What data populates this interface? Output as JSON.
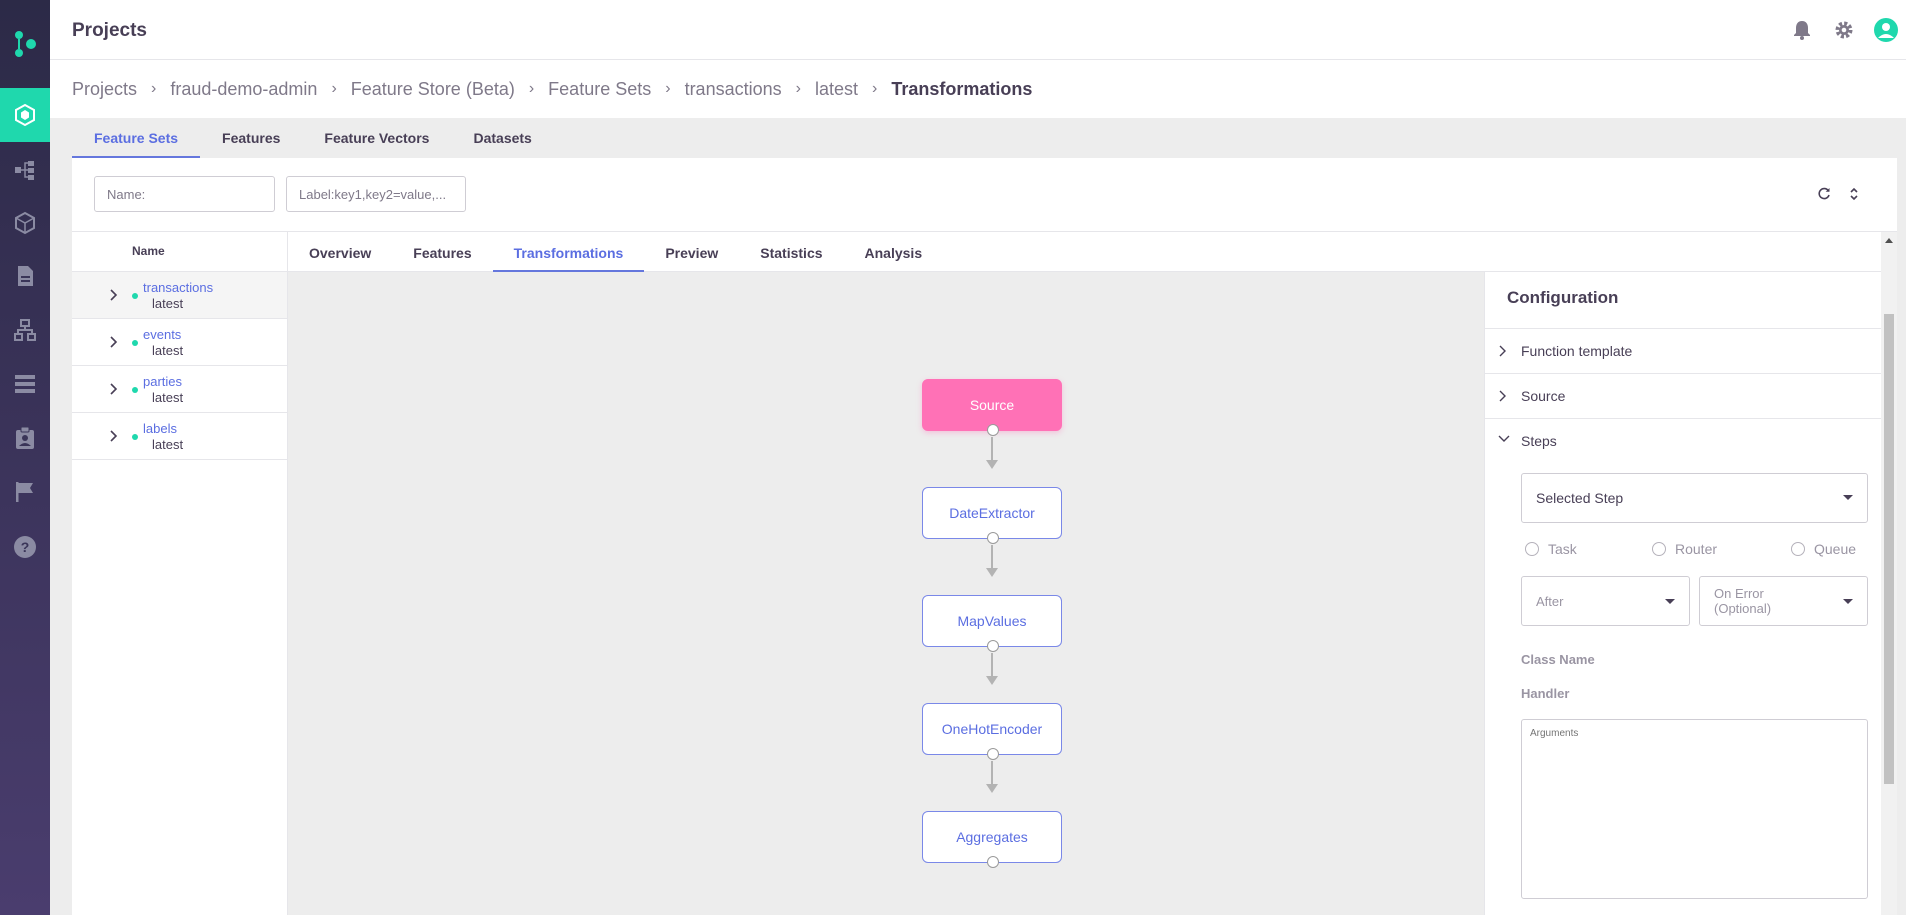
{
  "header": {
    "title": "Projects"
  },
  "breadcrumb": {
    "items": [
      "Projects",
      "fraud-demo-admin",
      "Feature Store (Beta)",
      "Feature Sets",
      "transactions",
      "latest"
    ],
    "current": "Transformations"
  },
  "content_tabs": [
    {
      "label": "Feature Sets",
      "active": true
    },
    {
      "label": "Features",
      "active": false
    },
    {
      "label": "Feature Vectors",
      "active": false
    },
    {
      "label": "Datasets",
      "active": false
    }
  ],
  "filters": {
    "name_placeholder": "Name:",
    "label_placeholder": "Label:key1,key2=value,..."
  },
  "table": {
    "header": "Name",
    "rows": [
      {
        "name": "transactions",
        "tag": "latest"
      },
      {
        "name": "events",
        "tag": "latest"
      },
      {
        "name": "parties",
        "tag": "latest"
      },
      {
        "name": "labels",
        "tag": "latest"
      }
    ]
  },
  "detail_tabs": [
    {
      "label": "Overview"
    },
    {
      "label": "Features"
    },
    {
      "label": "Transformations",
      "active": true
    },
    {
      "label": "Preview"
    },
    {
      "label": "Statistics"
    },
    {
      "label": "Analysis"
    }
  ],
  "graph": {
    "nodes": [
      "Source",
      "DateExtractor",
      "MapValues",
      "OneHotEncoder",
      "Aggregates"
    ]
  },
  "config": {
    "title": "Configuration",
    "sections": [
      "Function template",
      "Source",
      "Steps"
    ],
    "selected_step_placeholder": "Selected Step",
    "radios": [
      "Task",
      "Router",
      "Queue"
    ],
    "after_placeholder": "After",
    "on_error_placeholder": "On Error (Optional)",
    "on_error_line1": "On Error",
    "on_error_line2": "(Optional)",
    "class_name_label": "Class Name",
    "handler_label": "Handler",
    "arguments_placeholder": "Arguments"
  },
  "colors": {
    "accent": "#5b6ee1",
    "source_node": "#ff71b6",
    "status_dot": "#1fd8ad",
    "rail_active": "#1fd8ad"
  }
}
